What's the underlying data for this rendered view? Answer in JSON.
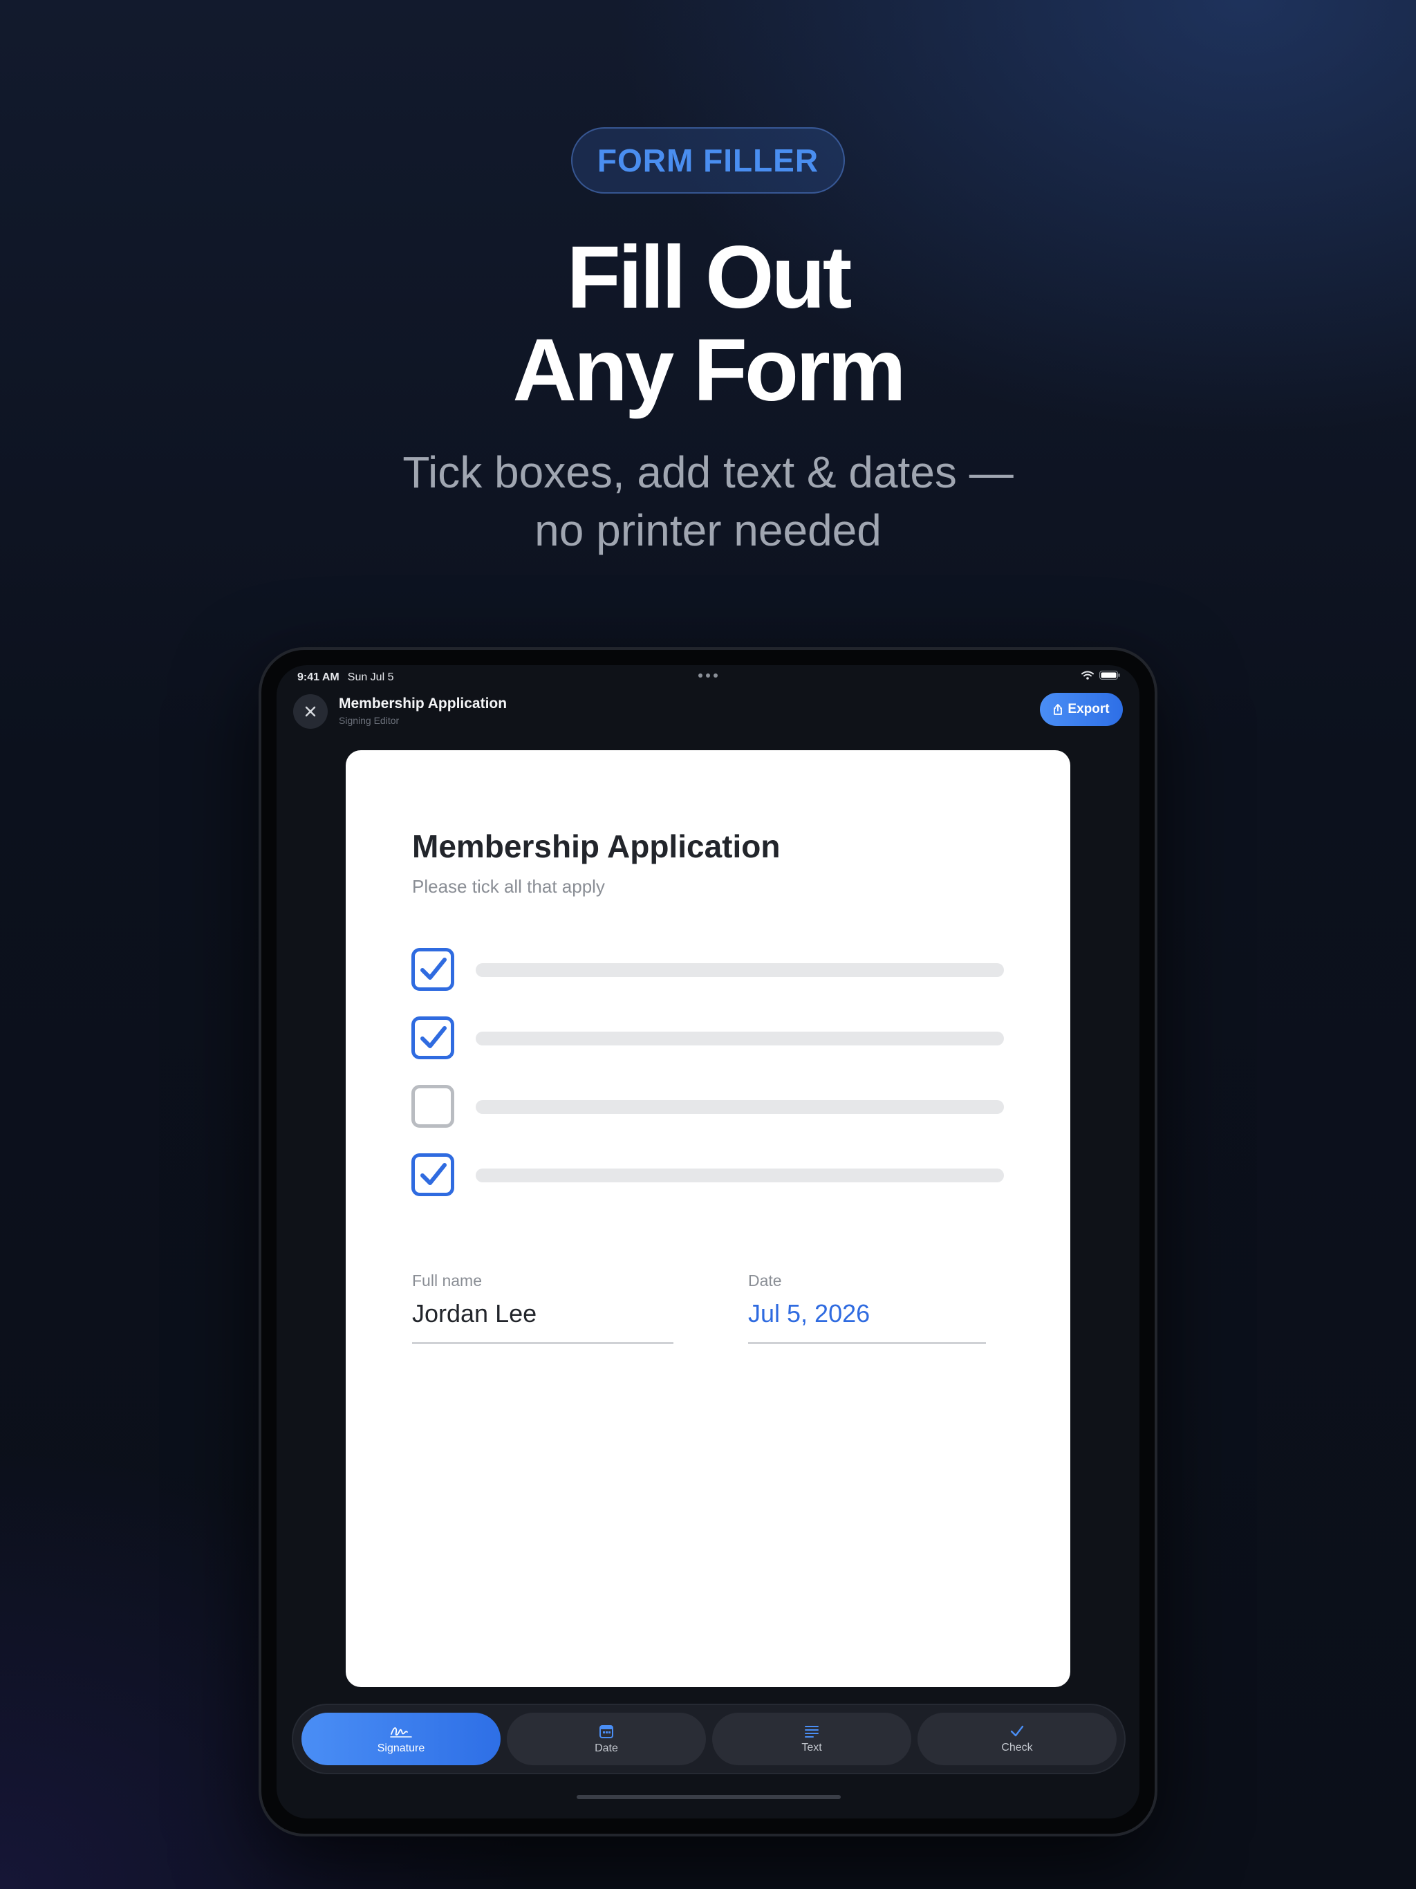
{
  "hero": {
    "badge": "FORM FILLER",
    "headline_line1": "Fill Out",
    "headline_line2": "Any Form",
    "subtitle_line1": "Tick boxes, add text & dates —",
    "subtitle_line2": "no printer needed"
  },
  "status_bar": {
    "time": "9:41 AM",
    "date": "Sun Jul 5",
    "icons": [
      "wifi-icon",
      "battery-icon"
    ]
  },
  "nav": {
    "close_icon": "close-icon",
    "title": "Membership Application",
    "subtitle": "Signing Editor",
    "export_label": "Export",
    "export_icon": "share-icon"
  },
  "document": {
    "title": "Membership Application",
    "instructions": "Please tick all that apply",
    "checkboxes": [
      {
        "checked": true
      },
      {
        "checked": true
      },
      {
        "checked": false
      },
      {
        "checked": true
      }
    ],
    "fields": {
      "full_name_label": "Full name",
      "full_name_value": "Jordan Lee",
      "date_label": "Date",
      "date_value": "Jul 5, 2026"
    }
  },
  "toolbar": {
    "tools": [
      {
        "label": "Signature",
        "icon": "signature-icon",
        "active": true
      },
      {
        "label": "Date",
        "icon": "calendar-icon",
        "active": false
      },
      {
        "label": "Text",
        "icon": "text-lines-icon",
        "active": false
      },
      {
        "label": "Check",
        "icon": "checkmark-icon",
        "active": false
      }
    ]
  },
  "colors": {
    "accent": "#2f6be0",
    "accent_light": "#4a8ef5",
    "background": "#0b0f19",
    "document": "#ffffff"
  }
}
